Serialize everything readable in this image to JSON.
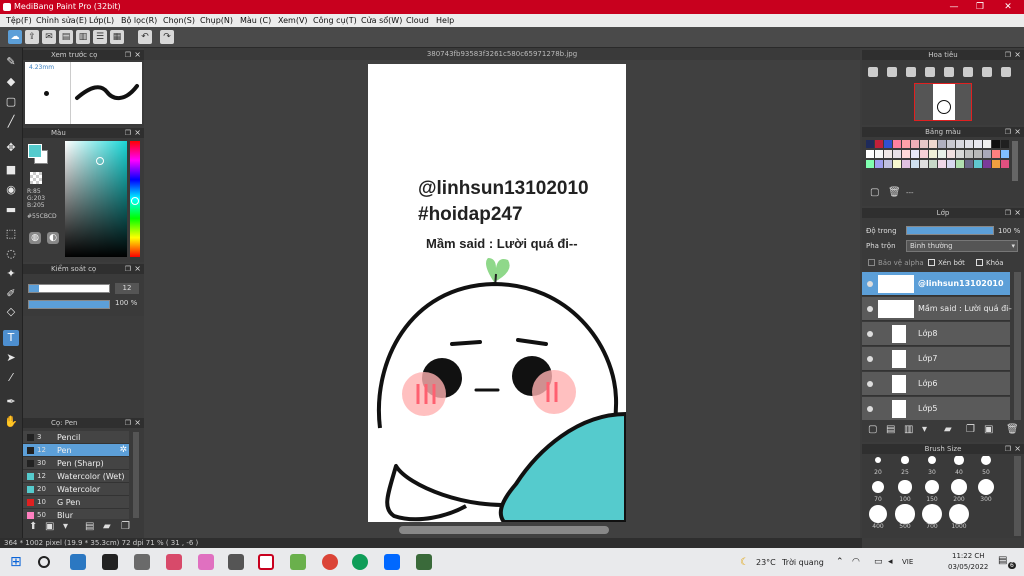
{
  "window": {
    "title": "MediBang Paint Pro (32bit)",
    "min_icon": "minimize-icon",
    "max_icon": "maximize-icon",
    "close_icon": "close-icon"
  },
  "menu": [
    "Tệp(F)",
    "Chỉnh sửa(E)",
    "Lớp(L)",
    "Bộ lọc(R)",
    "Chọn(S)",
    "Chụp(N)",
    "Màu (C)",
    "Xem(V)",
    "Công cụ(T)",
    "Cửa sổ(W)",
    "Cloud",
    "Help"
  ],
  "document": {
    "filename": "380743fb93583f3261c580c65971278b.jpg",
    "line1": "@linhsun13102010",
    "line2": "#hoidap247",
    "line3": "Mầm said : Lười quá đi--"
  },
  "preview": {
    "title": "Xem trước cọ",
    "size": "4.23mm"
  },
  "color_panel": {
    "title": "Màu",
    "r": "R:85",
    "g": "G:203",
    "b": "B:205",
    "hex": "#55CBCD"
  },
  "brush_control": {
    "title": "Kiểm soát cọ",
    "size_value": "12",
    "opacity_value": "100 %",
    "size_fraction": 0.12,
    "opacity_fraction": 1.0
  },
  "pen_panel": {
    "title": "Cọ: Pen",
    "items": [
      {
        "num": "3",
        "name": "Pencil",
        "color": "#222222"
      },
      {
        "num": "12",
        "name": "Pen",
        "color": "#55CBCD"
      },
      {
        "num": "30",
        "name": "Pen (Sharp)",
        "color": "#222222"
      },
      {
        "num": "12",
        "name": "Watercolor (Wet)",
        "color": "#55CBCD"
      },
      {
        "num": "20",
        "name": "Watercolor",
        "color": "#55CBCD"
      },
      {
        "num": "10",
        "name": "G Pen",
        "color": "#e02020"
      },
      {
        "num": "50",
        "name": "Blur",
        "color": "#ff80c0"
      }
    ]
  },
  "navigator": {
    "title": "Hoa tiêu"
  },
  "palette": {
    "title": "Bảng màu",
    "colors": [
      "#1e2a5a",
      "#c0203a",
      "#3050d0",
      "#ff80a0",
      "#ffa0a8",
      "#f0b0b8",
      "#e8c8c8",
      "#f0d8d0",
      "#b0b0c0",
      "#c8c8d0",
      "#d8d8e0",
      "#e0e0e8",
      "#e8e8f0",
      "#f0f0f0",
      "#101010",
      "#202020",
      "#ffffff",
      "#f8f8f8",
      "#f0e8e8",
      "#e8e0e8",
      "#ffd8d8",
      "#e8e8f8",
      "#f8d0d8",
      "#f0f0d8",
      "#e8f0e8",
      "#f0e0e0",
      "#d8d8d8",
      "#c0c0c0",
      "#b8b8b8",
      "#a8a8b8",
      "#ff8080",
      "#80c0ff",
      "#80ffb0",
      "#a0a0f0",
      "#c0c0e0",
      "#f8f8d0",
      "#e0c0e0",
      "#d0e0f0",
      "#e0e0e0",
      "#c8d8c8",
      "#f0d8e8",
      "#d8d8f0",
      "#b0e0b0",
      "#6a6a8a",
      "#60c8d0",
      "#7a3a9a",
      "#f0a040",
      "#e05080"
    ]
  },
  "layer_panel": {
    "title": "Lớp",
    "opacity_label": "Độ trong",
    "opacity_value": "100 %",
    "blend_label": "Pha trộn",
    "blend_value": "Bình thường",
    "alpha_label": "Bảo vệ alpha",
    "clip_label": "Xén bớt",
    "lock_label": "Khóa",
    "layers": [
      "@linhsun13102010",
      "Mầm said : Lười quá đi--",
      "Lớp8",
      "Lớp7",
      "Lớp6",
      "Lớp5"
    ]
  },
  "brush_size": {
    "title": "Brush Size",
    "sizes": [
      "20",
      "25",
      "30",
      "40",
      "50",
      "70",
      "100",
      "150",
      "200",
      "300",
      "400",
      "500",
      "700",
      "1000"
    ]
  },
  "status": {
    "text": "364 * 1002 pixel   (19.9 * 35.3cm)   72 dpi   71 %   ( 31 , -6 )"
  },
  "taskbar": {
    "weather_temp": "23°C",
    "weather_text": "Trời quang",
    "lang": "VIE",
    "time": "11:22 CH",
    "date": "03/05/2022",
    "notif_count": "6"
  }
}
